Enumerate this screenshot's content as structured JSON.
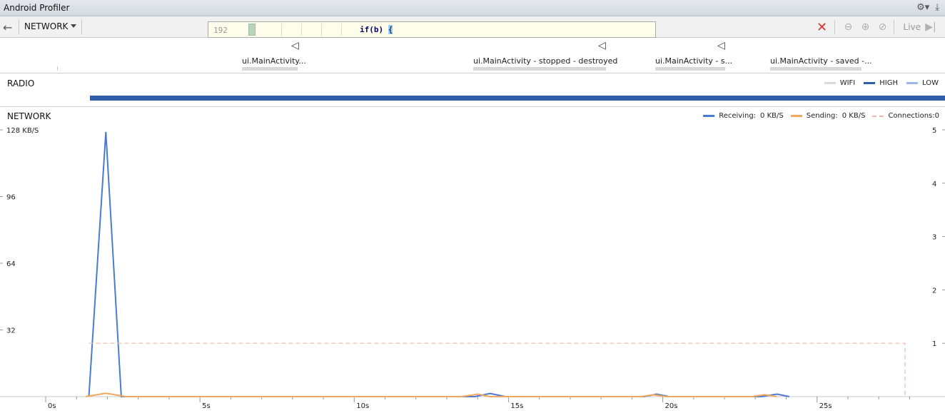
{
  "window": {
    "title": "Android Profiler"
  },
  "toolbar": {
    "profiler_select": "NETWORK",
    "code_popup": {
      "line_number": "192",
      "code": "if(b) ",
      "brace": "{"
    },
    "live_label": "Live"
  },
  "events": [
    {
      "label": "ui.MainActivity..."
    },
    {
      "label": "ui.MainActivity - stopped - destroyed"
    },
    {
      "label": "ui.MainActivity - s..."
    },
    {
      "label": "ui.MainActivity - saved -..."
    }
  ],
  "radio": {
    "label": "RADIO",
    "legend": [
      {
        "name": "WIFI",
        "color": "#d9d9d9"
      },
      {
        "name": "HIGH",
        "color": "#2f5ea8"
      },
      {
        "name": "LOW",
        "color": "#9bb8ea"
      }
    ],
    "state": "HIGH"
  },
  "network": {
    "label": "NETWORK",
    "legend": {
      "receiving_label": "Receiving:",
      "receiving_value": "0 KB/S",
      "sending_label": "Sending:",
      "sending_value": "0 KB/S",
      "connections_label": "Connections:",
      "connections_value": "0"
    },
    "colors": {
      "receiving": "#4a7bd0",
      "sending": "#f0a860",
      "connections": "#f0b8a8"
    }
  },
  "chart_data": {
    "type": "line",
    "title": "",
    "xlabel": "",
    "ylabel": "",
    "x_ticks": [
      "0s",
      "5s",
      "10s",
      "15s",
      "20s",
      "25s"
    ],
    "xlim": [
      0,
      28.5
    ],
    "y_left_ticks": [
      "32",
      "64",
      "96",
      "128 KB/S"
    ],
    "y_left_ticks_values": [
      32,
      64,
      96,
      128
    ],
    "ylim_left": [
      0,
      128
    ],
    "y_right_ticks": [
      "1",
      "2",
      "3",
      "4",
      "5"
    ],
    "y_right_ticks_values": [
      1,
      2,
      3,
      4,
      5
    ],
    "ylim_right": [
      0,
      5
    ],
    "series": [
      {
        "name": "Receiving",
        "axis": "left",
        "x": [
          1.4,
          1.95,
          2.45,
          13.9,
          14.4,
          14.9,
          19.4,
          19.8,
          20.2,
          23.2,
          23.7,
          24.1
        ],
        "y": [
          0,
          127,
          0,
          0,
          1.5,
          0,
          0,
          1.2,
          0,
          0,
          1.2,
          0
        ]
      },
      {
        "name": "Sending",
        "axis": "left",
        "x": [
          1.3,
          1.95,
          2.6,
          13.5,
          14.0,
          14.4,
          19.3,
          19.7,
          20.1,
          22.9,
          23.3,
          23.7
        ],
        "y": [
          0,
          1.6,
          0,
          0,
          1.2,
          0,
          0,
          0.9,
          0,
          0,
          0.9,
          0
        ]
      },
      {
        "name": "Connections",
        "axis": "right",
        "x": [
          1.4,
          27.85,
          27.85
        ],
        "y": [
          1,
          1,
          0
        ]
      }
    ]
  }
}
